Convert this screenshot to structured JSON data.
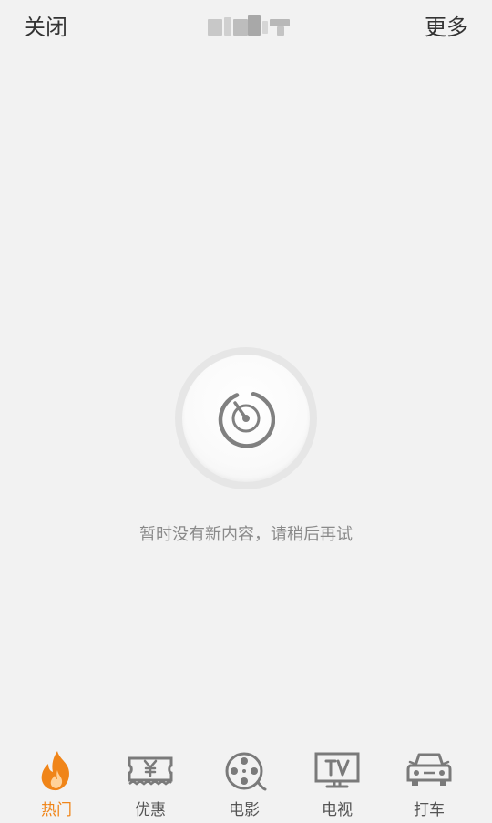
{
  "header": {
    "close_label": "关闭",
    "more_label": "更多"
  },
  "empty_state": {
    "icon": "radar-icon",
    "message": "暂时没有新内容，请稍后再试"
  },
  "colors": {
    "background": "#f2f2f2",
    "accent": "#f08519",
    "icon_gray": "#808080",
    "text_gray": "#8a8a8a"
  },
  "tabs": [
    {
      "label": "热门",
      "icon": "flame-icon",
      "active": true
    },
    {
      "label": "优惠",
      "icon": "coupon-icon",
      "active": false
    },
    {
      "label": "电影",
      "icon": "film-reel-icon",
      "active": false
    },
    {
      "label": "电视",
      "icon": "tv-icon",
      "active": false
    },
    {
      "label": "打车",
      "icon": "car-icon",
      "active": false
    }
  ]
}
